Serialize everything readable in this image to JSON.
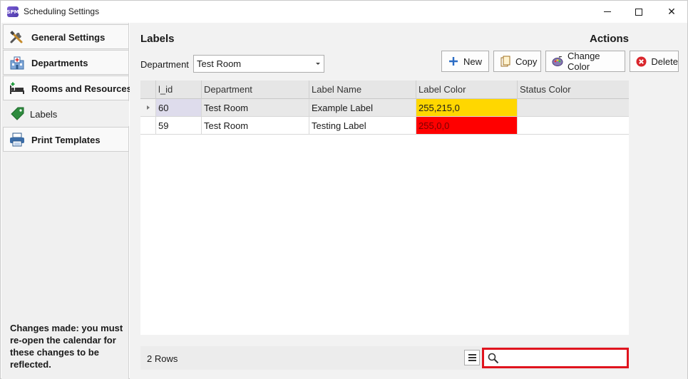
{
  "window": {
    "title": "Scheduling Settings",
    "app_icon_text": "SPM"
  },
  "sidebar": {
    "items": [
      {
        "label": "General Settings",
        "icon": "tools-icon"
      },
      {
        "label": "Departments",
        "icon": "hospital-icon"
      },
      {
        "label": "Rooms and Resources",
        "icon": "bed-icon"
      },
      {
        "label": "Labels",
        "icon": "tag-icon"
      },
      {
        "label": "Print Templates",
        "icon": "printer-icon"
      }
    ],
    "active_index": 3,
    "note": "Changes made: you must re-open the calendar for these changes to be reflected."
  },
  "main": {
    "heading": "Labels",
    "actions_heading": "Actions",
    "department_label": "Department",
    "department_value": "Test Room",
    "buttons": {
      "new": "New",
      "copy": "Copy",
      "change_color": "Change Color",
      "delete": "Delete"
    }
  },
  "grid": {
    "columns": [
      "l_id",
      "Department",
      "Label Name",
      "Label Color",
      "Status Color"
    ],
    "rows": [
      {
        "l_id": "60",
        "department": "Test Room",
        "label_name": "Example Label",
        "label_color": "255,215,0",
        "status_color": "",
        "color_hex": "#ffd700"
      },
      {
        "l_id": "59",
        "department": "Test Room",
        "label_name": "Testing Label",
        "label_color": "255,0,0",
        "status_color": "",
        "color_hex": "#ff0000"
      }
    ],
    "footer": {
      "row_count": "2 Rows",
      "search_placeholder": ""
    }
  },
  "colors": {
    "search_highlight": "#e0141e",
    "selected_row": "#e8e8e8",
    "selected_id_cell": "#dedcec"
  }
}
